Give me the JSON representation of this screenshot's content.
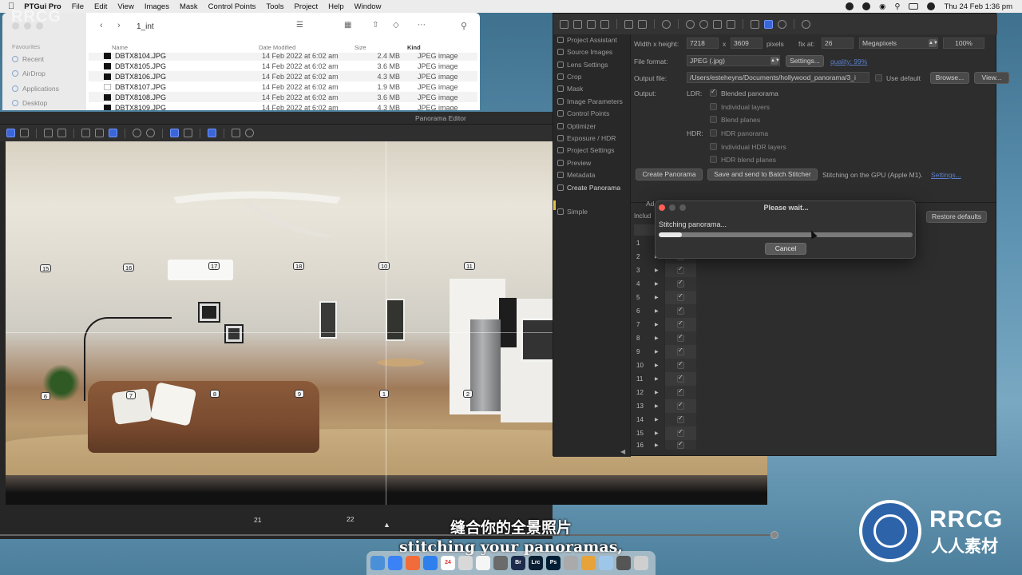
{
  "menubar": {
    "app_name": "PTGui Pro",
    "items": [
      "File",
      "Edit",
      "View",
      "Images",
      "Mask",
      "Control Points",
      "Tools",
      "Project",
      "Help",
      "Window"
    ],
    "clock": "Thu 24 Feb  1:36 pm"
  },
  "finder": {
    "folder_title": "1_int",
    "favourites_header": "Favourites",
    "sidebar": [
      "Recent",
      "AirDrop",
      "Applications",
      "Desktop"
    ],
    "columns": {
      "name": "Name",
      "date": "Date Modified",
      "size": "Size",
      "kind": "Kind"
    },
    "rows": [
      {
        "name": "DBTX8104.JPG",
        "date": "14 Feb 2022 at 6:02 am",
        "size": "2.4 MB",
        "kind": "JPEG image"
      },
      {
        "name": "DBTX8105.JPG",
        "date": "14 Feb 2022 at 6:02 am",
        "size": "3.6 MB",
        "kind": "JPEG image"
      },
      {
        "name": "DBTX8106.JPG",
        "date": "14 Feb 2022 at 6:02 am",
        "size": "4.3 MB",
        "kind": "JPEG image"
      },
      {
        "name": "DBTX8107.JPG",
        "date": "14 Feb 2022 at 6:02 am",
        "size": "1.9 MB",
        "kind": "JPEG image"
      },
      {
        "name": "DBTX8108.JPG",
        "date": "14 Feb 2022 at 6:02 am",
        "size": "3.6 MB",
        "kind": "JPEG image"
      },
      {
        "name": "DBTX8109.JPG",
        "date": "14 Feb 2022 at 6:02 am",
        "size": "4.3 MB",
        "kind": "JPEG image"
      }
    ]
  },
  "panorama_editor": {
    "title": "Panorama Editor",
    "control_points": [
      "15",
      "16",
      "17",
      "18",
      "10",
      "11",
      "6",
      "7",
      "8",
      "9",
      "1",
      "2",
      "21",
      "22"
    ]
  },
  "project": {
    "sidebar": [
      "Project Assistant",
      "Source Images",
      "Lens Settings",
      "Crop",
      "Mask",
      "Image Parameters",
      "Control Points",
      "Optimizer",
      "Exposure / HDR",
      "Project Settings",
      "Preview",
      "Metadata",
      "Create Panorama",
      "Simple"
    ],
    "width_height_label": "Width x height:",
    "width": "7218",
    "x_sep": "x",
    "height": "3609",
    "pixels_label": "pixels",
    "fix_at_label": "fix at:",
    "fix_at_value": "26",
    "unit_select": "Megapixels",
    "zoom": "100%",
    "file_format_label": "File format:",
    "file_format": "JPEG (.jpg)",
    "settings_button": "Settings...",
    "quality_link": "quality: 99%",
    "output_file_label": "Output file:",
    "output_file": "/Users/esteheyns/Documents/hollywood_panorama/3_i",
    "use_default": "Use default",
    "browse_button": "Browse...",
    "view_button": "View...",
    "output_label": "Output:",
    "ldr_label": "LDR:",
    "hdr_label": "HDR:",
    "ldr_options": [
      {
        "label": "Blended panorama",
        "checked": true
      },
      {
        "label": "Individual layers",
        "checked": false
      },
      {
        "label": "Blend planes",
        "checked": false
      }
    ],
    "hdr_options": [
      {
        "label": "HDR panorama",
        "checked": false
      },
      {
        "label": "Individual HDR layers",
        "checked": false
      },
      {
        "label": "HDR blend planes",
        "checked": false
      }
    ],
    "create_button": "Create Panorama",
    "batch_button": "Save and send to Batch Stitcher",
    "gpu_text": "Stitching on the GPU (Apple M1).",
    "gpu_settings_link": "Settings...",
    "adv_label": "Ad",
    "include_label": "Includ",
    "restore_button": "Restore defaults",
    "image_rows": [
      "1",
      "2",
      "3",
      "4",
      "5",
      "6",
      "7",
      "8",
      "9",
      "10",
      "11",
      "12",
      "13",
      "14",
      "15",
      "16"
    ]
  },
  "dialog": {
    "title": "Please wait...",
    "message": "Stitching panorama...",
    "progress": 0.09,
    "cancel": "Cancel"
  },
  "subtitles": {
    "cn": "缝合你的全景照片",
    "en": "stitching your panoramas,"
  },
  "watermark": {
    "corner": "RRCG",
    "brand": "RRCG",
    "brand_cn": "人人素材"
  },
  "dock": {
    "calendar_day": "24",
    "br": "Br",
    "lrc": "Lrc",
    "ps": "Ps"
  }
}
